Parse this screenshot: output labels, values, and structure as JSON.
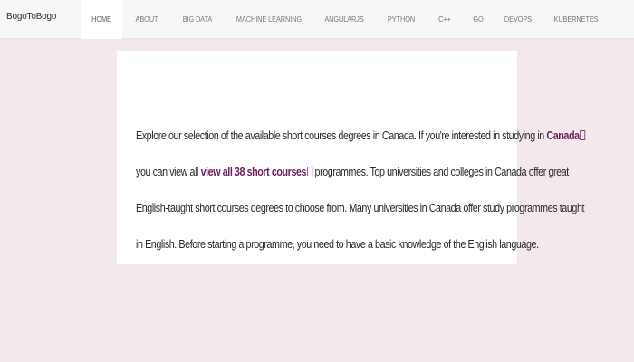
{
  "brand": "BogoToBogo",
  "nav": {
    "items": [
      {
        "label": "HOME",
        "active": true
      },
      {
        "label": "ABOUT"
      },
      {
        "label": "BIG DATA"
      },
      {
        "label": "MACHINE LEARNING"
      },
      {
        "label": "ANGULARJS"
      },
      {
        "label": "PYTHON"
      },
      {
        "label": "C++"
      },
      {
        "label": "GO"
      },
      {
        "label": "DEVOPS"
      },
      {
        "label": "KUBERNETES"
      }
    ]
  },
  "content": {
    "line1_text": "Explore our selection of the available short courses degrees in Canada. If you're interested in studying in ",
    "line1_link": "Canada",
    "line2_pre": "you can view all ",
    "line2_link": "view all 38 short courses",
    "line2_post": " programmes. Top universities and colleges in Canada offer great",
    "line3": "English-taught short courses degrees to choose from. Many universities in Canada offer study programmes taught",
    "line4": "in English. Before starting a programme, you need to have a basic knowledge of the English language."
  },
  "colors": {
    "background": "#f3e8ea",
    "navbar": "#f7f7f7",
    "link": "#6b1f5e"
  }
}
